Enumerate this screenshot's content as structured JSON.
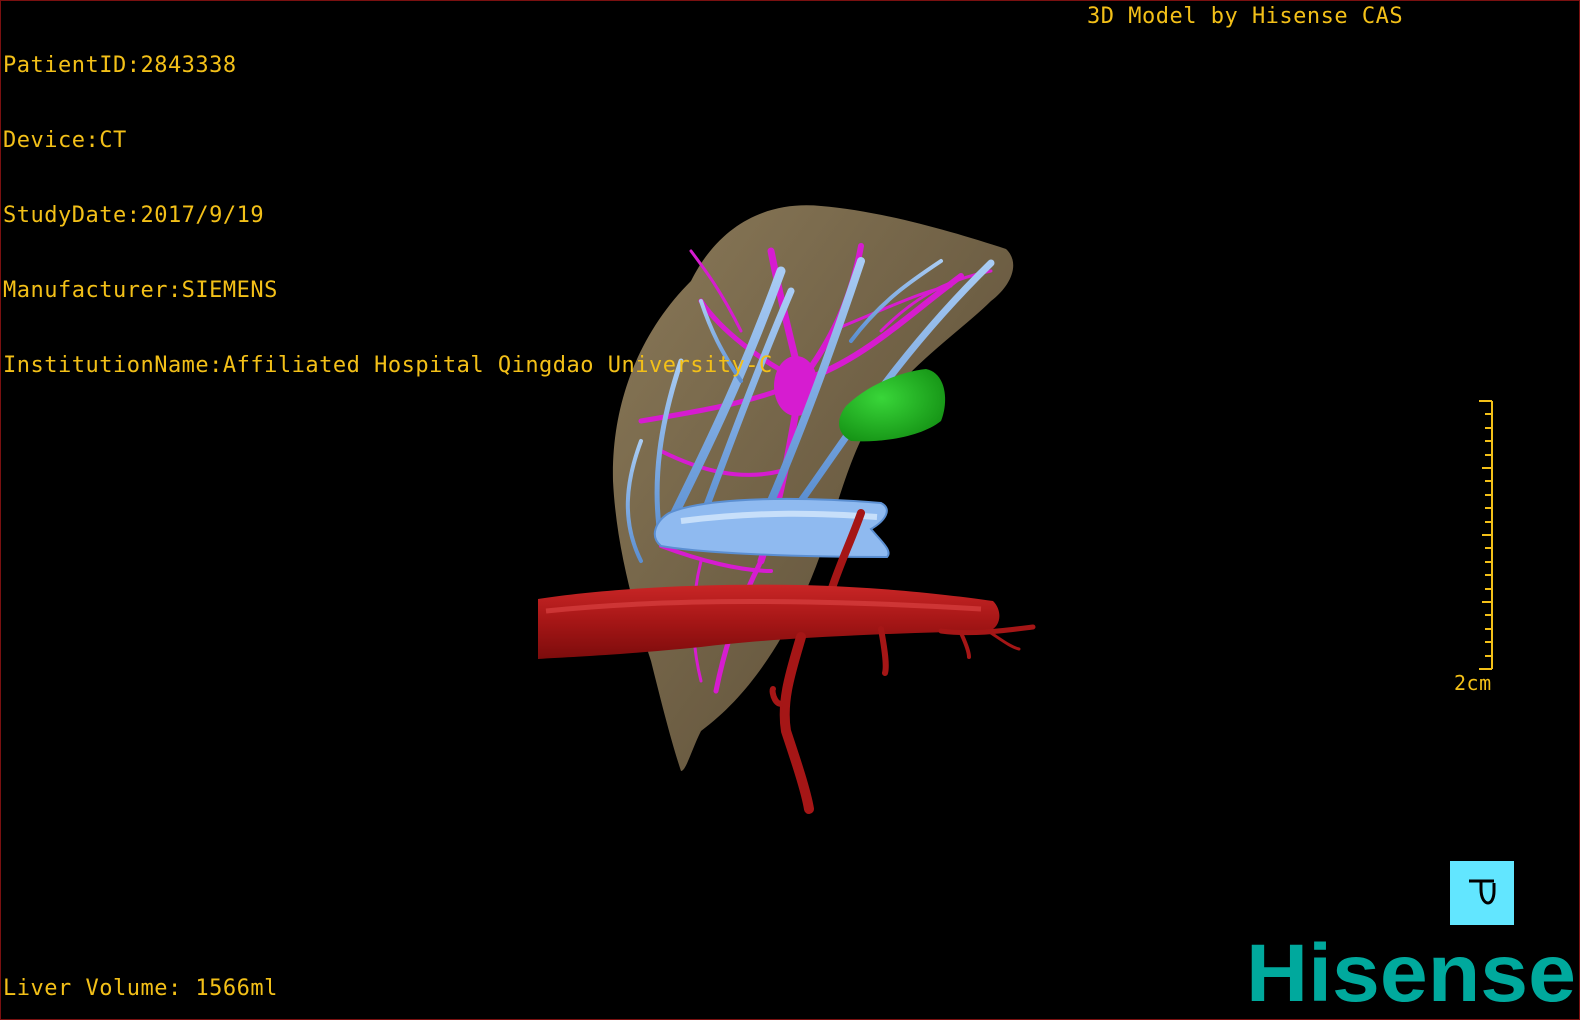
{
  "viewer": {
    "info_lines": [
      "PatientID:2843338",
      "Device:CT",
      "StudyDate:2017/9/19",
      "Manufacturer:SIEMENS",
      "InstitutionName:Affiliated Hospital Qingdao University-C"
    ],
    "model_credit": "3D Model by Hisense CAS",
    "liver_volume": "Liver Volume: 1566ml",
    "scale_bar_label": "2cm",
    "overlay_color": "#f3c018"
  },
  "model": {
    "liver_color": "#7a6a50",
    "hepatic_vein_color": "#6a9fdc",
    "portal_vein_color": "#d61cd0",
    "artery_color": "#b41a1a",
    "tumor_color": "#1fb51f"
  },
  "orientation_cube": {
    "face_label": "T",
    "color": "#62e6ff"
  },
  "brand": {
    "logo_text": "Hisense",
    "color": "#00a99d"
  }
}
